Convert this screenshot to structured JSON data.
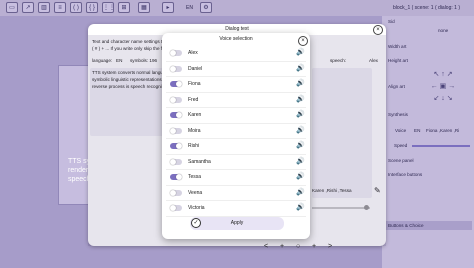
{
  "toolbar": {
    "buttons": [
      "▭",
      "↗",
      "▥",
      "≡",
      "(  )",
      "{  }",
      "⋮⋮",
      "⊞",
      "▦",
      "▸"
    ],
    "lang": "EN",
    "title": "block_1 ( scene: 1 ( dialog: 1 )"
  },
  "right_panel": {
    "sid": "Sid",
    "width_art": "Width art",
    "height_art": "Height art",
    "align_art": "Align art",
    "synthesis": "Synthesis",
    "voice_label": "Voice",
    "voice_lang": "EN",
    "voice_value": "Fiona ,Karen ,Ri",
    "speed": "Speed",
    "scene_panel": "Scene panel",
    "interface_buttons": "Interface buttons",
    "buttons_choice": "Buttons & Choice",
    "none": "none"
  },
  "dialog_text": {
    "title": "Dialog text",
    "intro": "Text and character name settings that are ... added furigana or annotations use + ||| ≡",
    "intro2": "( # ) + ... If you write only skip the form",
    "language_label": "language:",
    "language_value": "EN",
    "symbols": "symbols: 196",
    "wo_label": "wo",
    "speech_label": "speech:",
    "speech_value": "Alex",
    "tts_text1": "TTS system converts normal languag",
    "tts_text2": "symbolic linguistic representations lik",
    "tts_text3": "reverse process is speech recognitio",
    "voices_field": "Karen ,Rishi ,Tessa",
    "canvas_text1": "TTS sy",
    "canvas_text2": "render",
    "canvas_text3": "speech"
  },
  "voice_selection": {
    "title": "Voice selection",
    "apply": "Apply",
    "voices": [
      {
        "name": "Alex",
        "on": false
      },
      {
        "name": "Daniel",
        "on": false
      },
      {
        "name": "Fiona",
        "on": true
      },
      {
        "name": "Fred",
        "on": false
      },
      {
        "name": "Karen",
        "on": true
      },
      {
        "name": "Moira",
        "on": false
      },
      {
        "name": "Rishi",
        "on": true
      },
      {
        "name": "Samantha",
        "on": false
      },
      {
        "name": "Tessa",
        "on": true
      },
      {
        "name": "Veena",
        "on": false
      },
      {
        "name": "Victoria",
        "on": false
      }
    ]
  },
  "bottom_bar": [
    "<",
    "+",
    "○",
    "+",
    ">"
  ],
  "colors": {
    "accent": "#7b6fbf",
    "background": "#b9afd2",
    "dialog": "#ffffff"
  }
}
